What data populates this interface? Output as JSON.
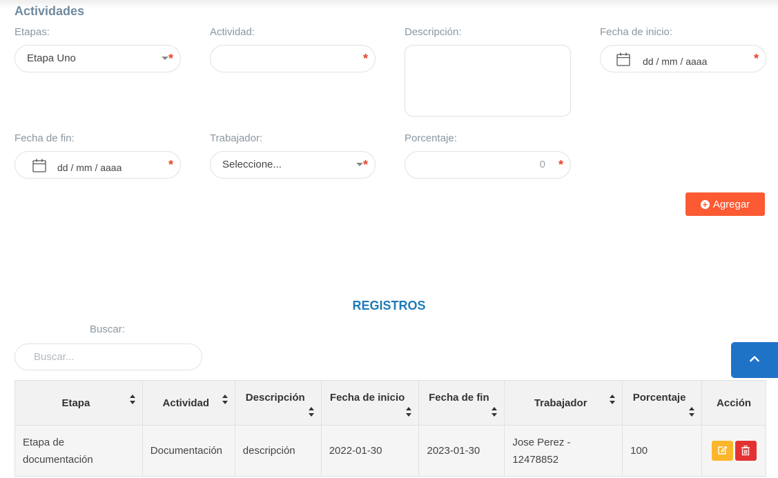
{
  "section": {
    "title": "Actividades"
  },
  "form": {
    "etapas": {
      "label": "Etapas:",
      "value": "Etapa Uno"
    },
    "actividad": {
      "label": "Actividad:",
      "value": ""
    },
    "descripcion": {
      "label": "Descripción:",
      "value": ""
    },
    "fecha_inicio": {
      "label": "Fecha de inicio:",
      "placeholder": "dd / mm / aaaa"
    },
    "fecha_fin": {
      "label": "Fecha de fin:",
      "placeholder": "dd / mm / aaaa"
    },
    "trabajador": {
      "label": "Trabajador:",
      "value": "Seleccione..."
    },
    "porcentaje": {
      "label": "Porcentaje:",
      "value": "0"
    },
    "required_mark": "*",
    "add_button": "Agregar"
  },
  "registros": {
    "title": "REGISTROS",
    "search_label": "Buscar:",
    "search_placeholder": "Buscar..."
  },
  "table": {
    "headers": {
      "etapa": "Etapa",
      "actividad": "Actividad",
      "descripcion": "Descripción",
      "fecha_inicio": "Fecha de inicio",
      "fecha_fin": "Fecha de fin",
      "trabajador": "Trabajador",
      "porcentaje": "Porcentaje",
      "accion": "Acción"
    },
    "rows": [
      {
        "etapa": "Etapa de documentación",
        "actividad": "Documentación",
        "descripcion": "descripción",
        "fecha_inicio": "2022-01-30",
        "fecha_fin": "2023-01-30",
        "trabajador": "Jose Perez - 12478852",
        "porcentaje": "100"
      }
    ]
  },
  "icons": {
    "calendar": "calendar-icon",
    "plus_circle": "plus-circle-icon",
    "edit": "edit-icon",
    "delete": "trash-icon",
    "scroll_top": "chevron-up-icon"
  },
  "colors": {
    "accent_orange": "#fb5a33",
    "title_blue": "#1f7ab8",
    "scroll_blue": "#1f73c7",
    "edit_yellow": "#fbb629",
    "delete_red": "#e33232",
    "required_red": "#e8442a"
  }
}
